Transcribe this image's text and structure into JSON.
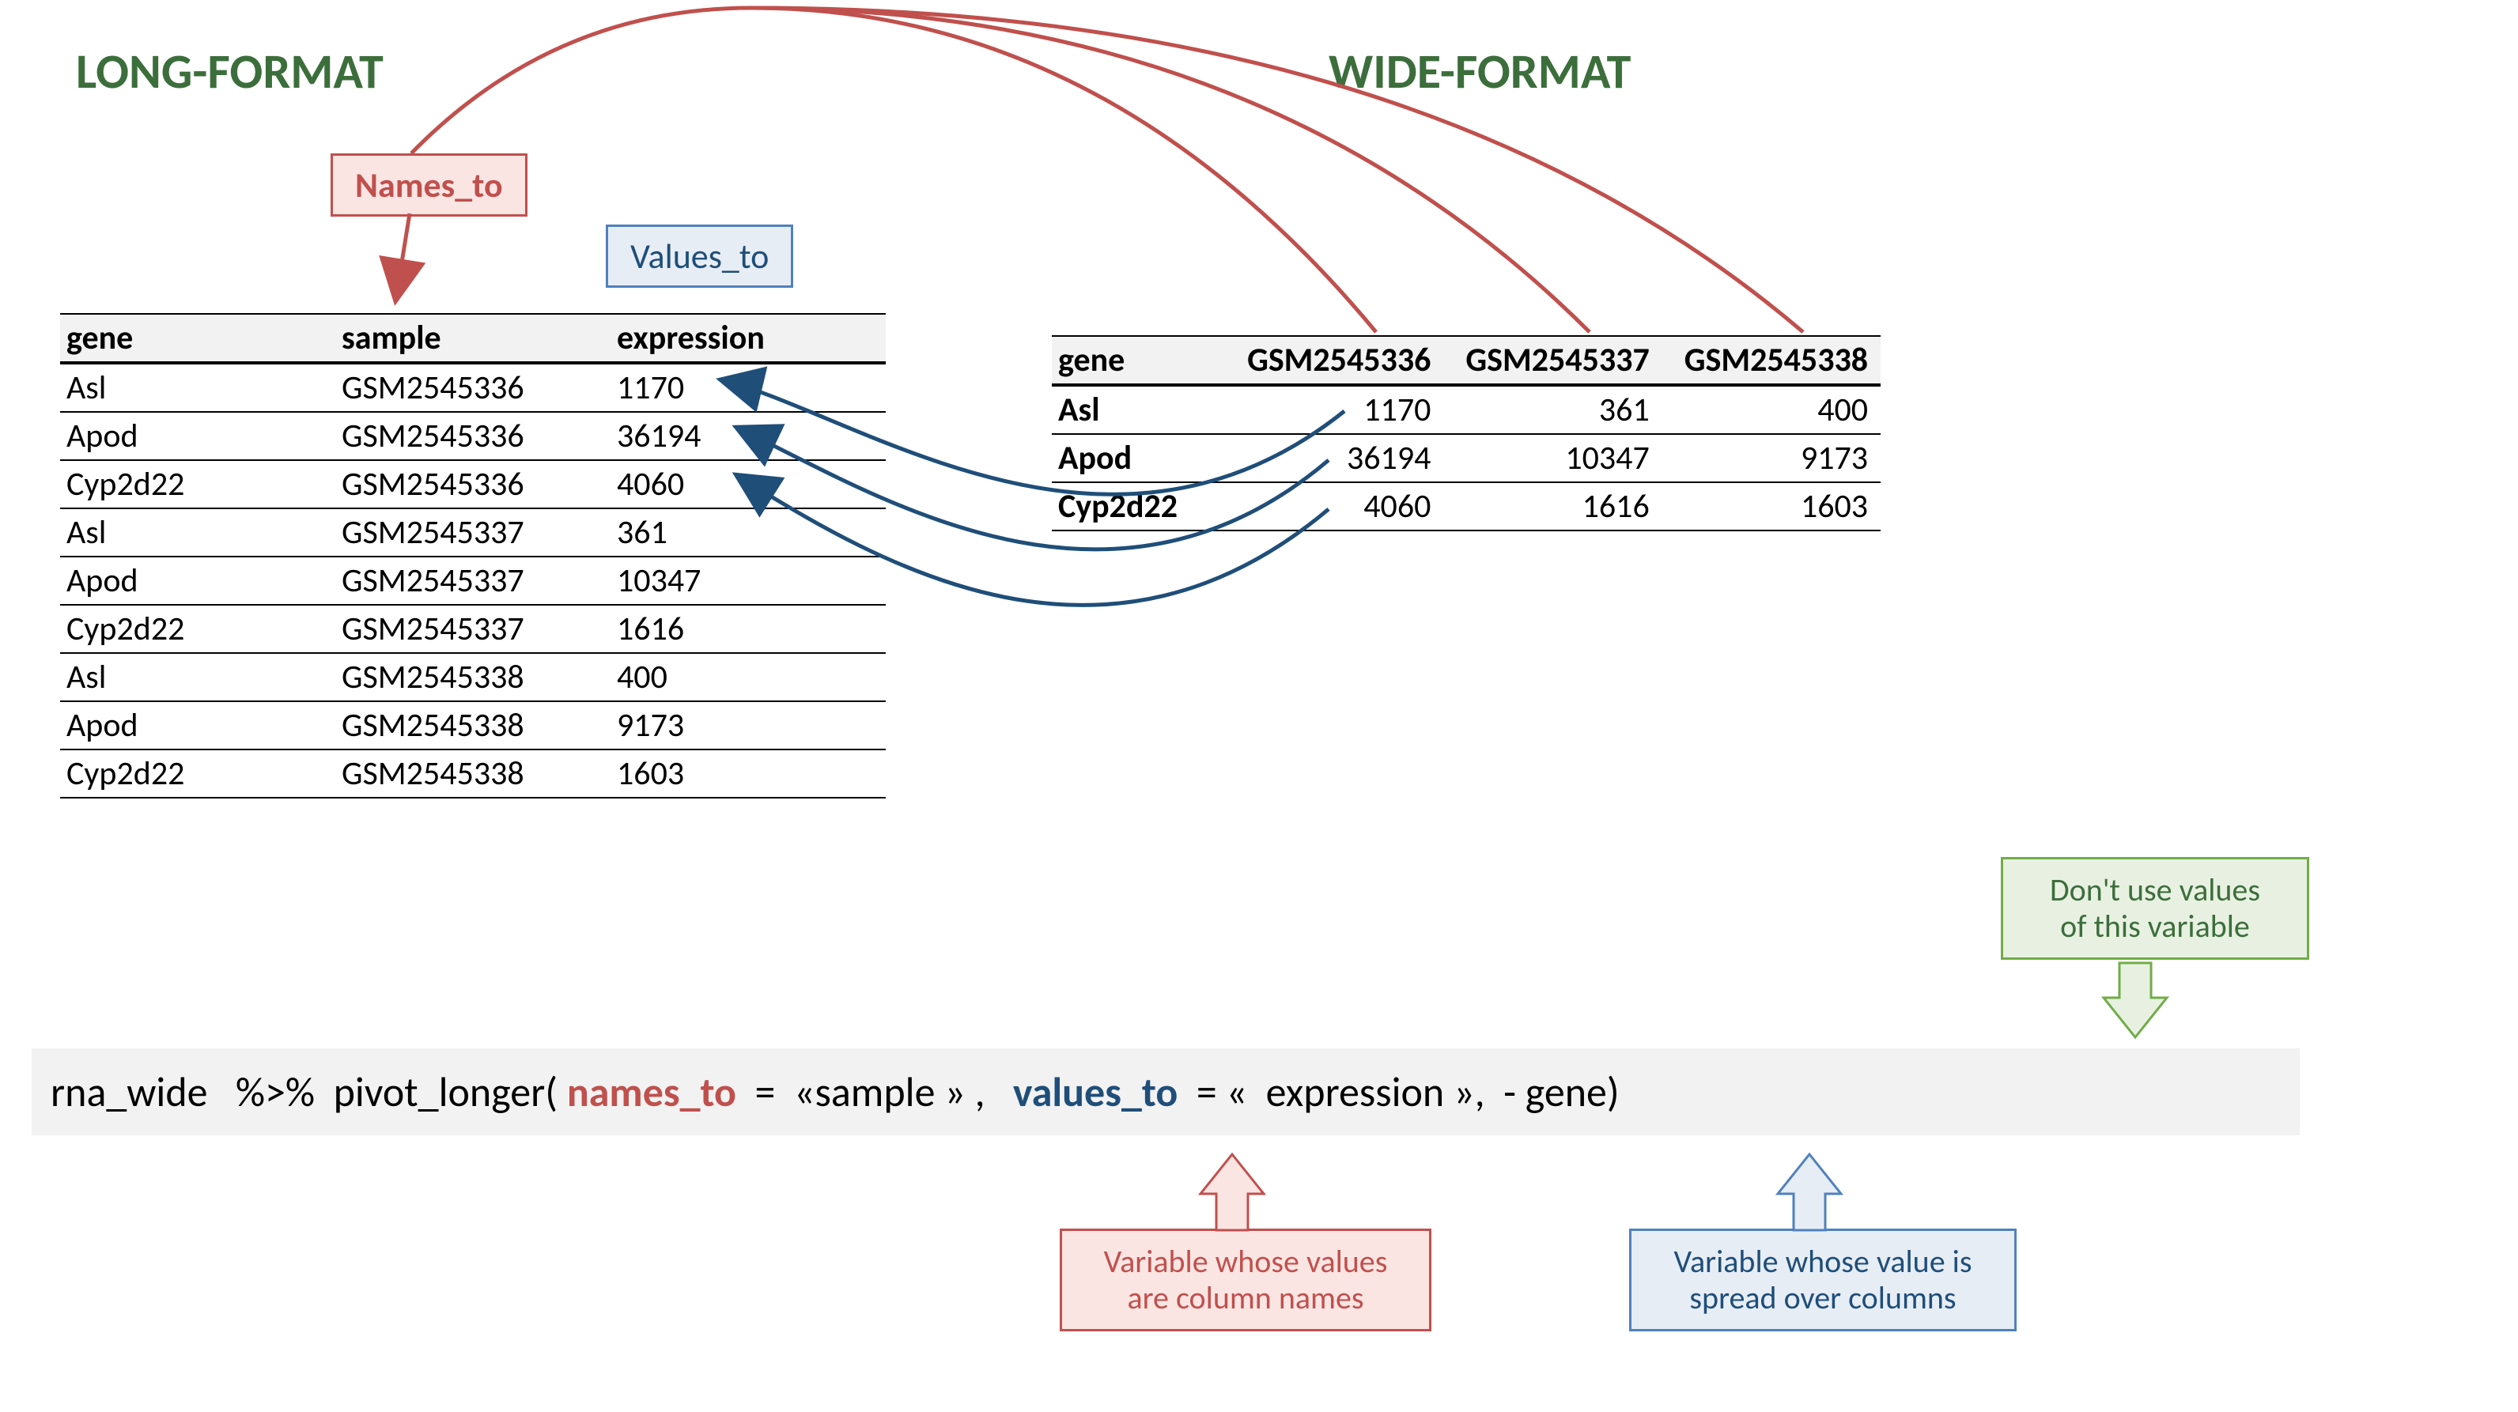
{
  "titles": {
    "long": "LONG-FORMAT",
    "wide": "WIDE-FORMAT"
  },
  "labels": {
    "names_to": "Names_to",
    "values_to": "Values_to"
  },
  "long_table": {
    "headers": [
      "gene",
      "sample",
      "expression"
    ],
    "rows": [
      [
        "Asl",
        "GSM2545336",
        "1170"
      ],
      [
        "Apod",
        "GSM2545336",
        "36194"
      ],
      [
        "Cyp2d22",
        "GSM2545336",
        "4060"
      ],
      [
        "Asl",
        "GSM2545337",
        "361"
      ],
      [
        "Apod",
        "GSM2545337",
        "10347"
      ],
      [
        "Cyp2d22",
        "GSM2545337",
        "1616"
      ],
      [
        "Asl",
        "GSM2545338",
        "400"
      ],
      [
        "Apod",
        "GSM2545338",
        "9173"
      ],
      [
        "Cyp2d22",
        "GSM2545338",
        "1603"
      ]
    ]
  },
  "wide_table": {
    "headers": [
      "gene",
      "GSM2545336",
      "GSM2545337",
      "GSM2545338"
    ],
    "rows": [
      [
        "Asl",
        "1170",
        "361",
        "400"
      ],
      [
        "Apod",
        "36194",
        "10347",
        "9173"
      ],
      [
        "Cyp2d22",
        "4060",
        "1616",
        "1603"
      ]
    ]
  },
  "code": {
    "p1": "rna_wide   %>%  pivot_longer( ",
    "names_to": "names_to",
    "p2": "  =  «sample » ,   ",
    "values_to": "values_to",
    "p3": "  = «  expression »,  - gene)"
  },
  "callouts": {
    "red": "Variable whose values\nare column names",
    "blue": "Variable whose value is\nspread over columns",
    "green": "Don't use values\nof this variable"
  }
}
